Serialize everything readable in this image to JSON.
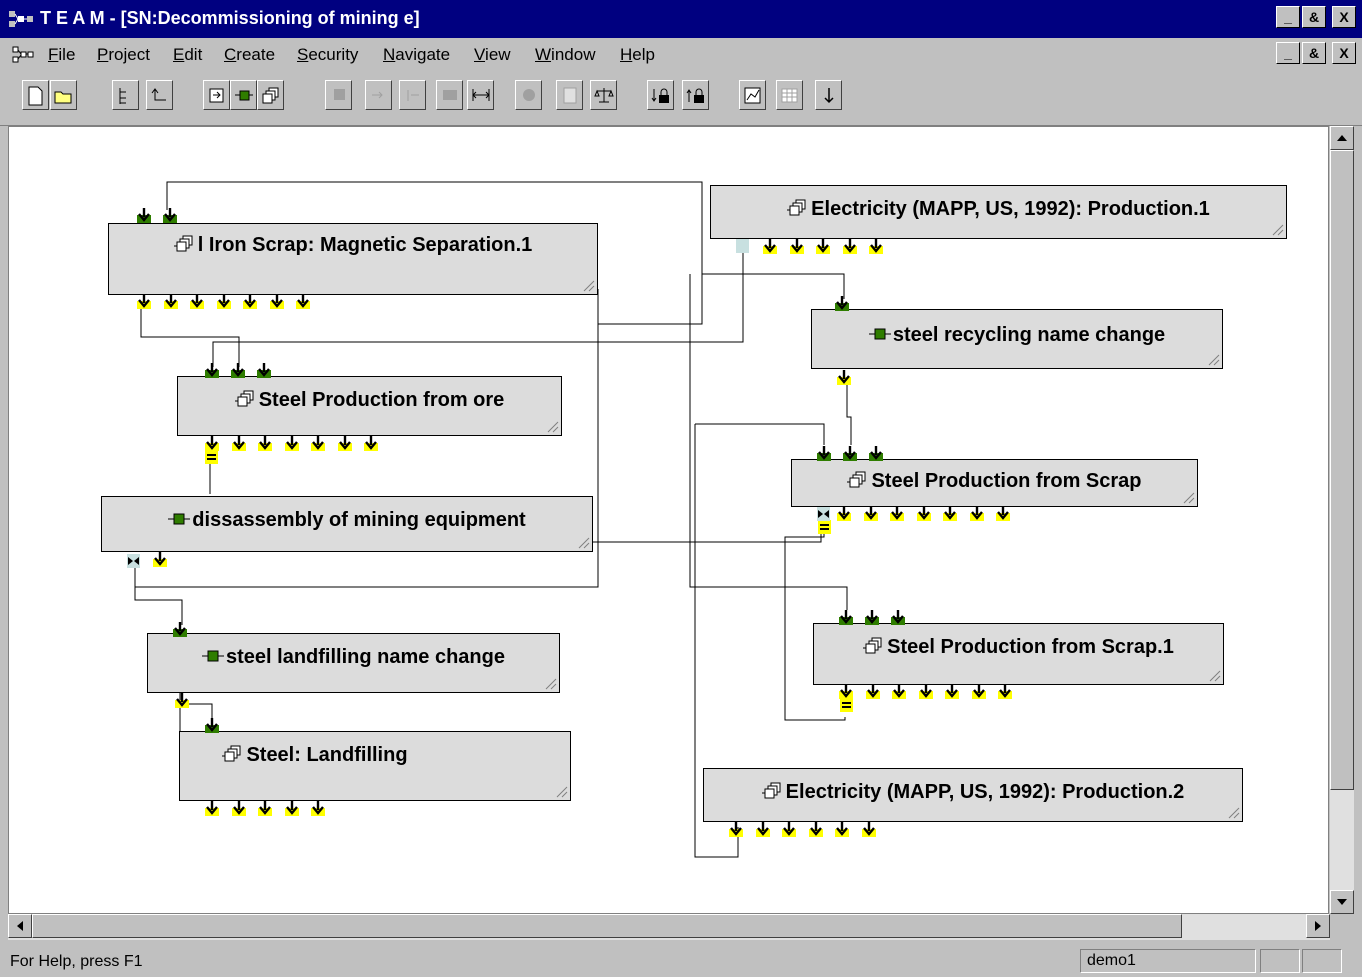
{
  "window": {
    "title": "T E A M - [SN:Decommissioning of mining e]",
    "buttons": [
      "_",
      "&",
      "X"
    ]
  },
  "menu": {
    "items": [
      {
        "label": "File",
        "key": "F",
        "rest": "ile"
      },
      {
        "label": "Project",
        "key": "P",
        "rest": "roject"
      },
      {
        "label": "Edit",
        "key": "E",
        "rest": "dit"
      },
      {
        "label": "Create",
        "key": "C",
        "rest": "reate"
      },
      {
        "label": "Security",
        "key": "S",
        "rest": "ecurity"
      },
      {
        "label": "Navigate",
        "key": "N",
        "rest": "avigate"
      },
      {
        "label": "View",
        "key": "V",
        "rest": "iew"
      },
      {
        "label": "Window",
        "key": "W",
        "rest": "indow"
      },
      {
        "label": "Help",
        "key": "H",
        "rest": "elp"
      }
    ]
  },
  "nodes": [
    {
      "id": "n1",
      "label": "l Iron Scrap: Magnetic Separation.1",
      "kind": "module"
    },
    {
      "id": "n2",
      "label": "Electricity (MAPP, US, 1992): Production.1",
      "kind": "module"
    },
    {
      "id": "n3",
      "label": "steel recycling name change",
      "kind": "process"
    },
    {
      "id": "n4",
      "label": "Steel Production from ore",
      "kind": "module"
    },
    {
      "id": "n5",
      "label": "Steel Production from Scrap",
      "kind": "module"
    },
    {
      "id": "n6",
      "label": "dissassembly of mining equipment",
      "kind": "process"
    },
    {
      "id": "n7",
      "label": "Steel Production from Scrap.1",
      "kind": "module"
    },
    {
      "id": "n8",
      "label": "steel landfilling name change",
      "kind": "process"
    },
    {
      "id": "n9",
      "label": "Steel: Landfilling",
      "kind": "module"
    },
    {
      "id": "n10",
      "label": "Electricity (MAPP, US, 1992): Production.2",
      "kind": "module"
    }
  ],
  "status": {
    "help": "For Help, press F1",
    "user": "demo1"
  },
  "colors": {
    "titlebar": "#000080",
    "port_green": "#2f7d00",
    "port_yellow": "#ffff00",
    "node_fill": "#dcdcdc"
  }
}
